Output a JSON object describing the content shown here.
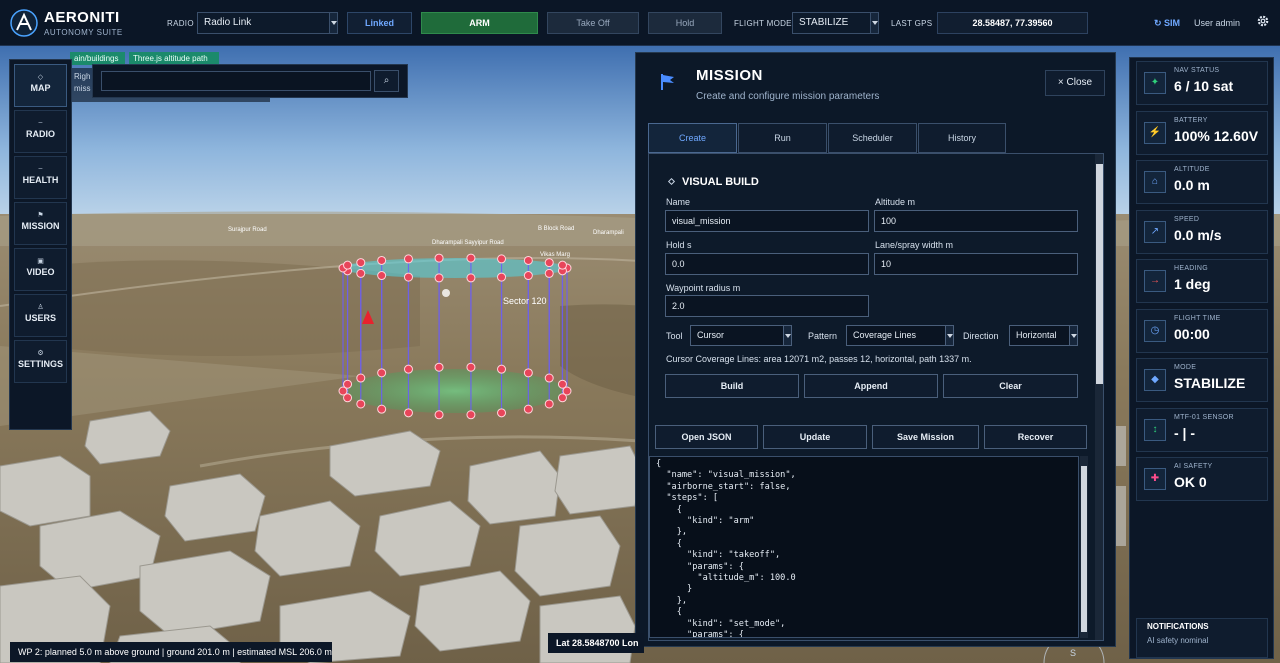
{
  "app": {
    "name": "AERONITI",
    "subtitle": "AUTONOMY SUITE"
  },
  "topbar": {
    "radio_label": "RADIO",
    "radio_value": "Radio Link",
    "linked_label": "Linked",
    "arm_label": "ARM",
    "takeoff_label": "Take Off",
    "hold_label": "Hold",
    "flight_mode_label": "FLIGHT MODE",
    "flight_mode_value": "STABILIZE",
    "last_gps_label": "LAST GPS",
    "last_gps_value": "28.58487, 77.39560",
    "sim_label": "↻ SIM",
    "user_label": "User admin",
    "gear_icon": "gear-icon"
  },
  "nav": {
    "items": [
      {
        "label": "MAP",
        "icon": "◇"
      },
      {
        "label": "RADIO",
        "icon": "–"
      },
      {
        "label": "HEALTH",
        "icon": "–"
      },
      {
        "label": "MISSION",
        "icon": "⚑"
      },
      {
        "label": "VIDEO",
        "icon": "▣"
      },
      {
        "label": "USERS",
        "icon": "♙"
      },
      {
        "label": "SETTINGS",
        "icon": "⚙"
      }
    ]
  },
  "map": {
    "tag_terrain": "ain/buildings",
    "tag_path": "Three.js altitude path",
    "info_line1": "Righ",
    "info_line2": "miss",
    "search_value": "",
    "search_button": "⌕",
    "sector_label": "Sector 120",
    "place_labels": [
      "Surajpur Road",
      "Dharampali Sayyipur Road",
      "Vikas Marg",
      "B Block Road",
      "Dharampali"
    ]
  },
  "mission": {
    "title": "MISSION",
    "subtitle": "Create and configure mission parameters",
    "close_label": "×  Close",
    "tabs": [
      "Create",
      "Run",
      "Scheduler",
      "History"
    ],
    "active_tab": "Create",
    "section_title": "VISUAL BUILD",
    "fields": {
      "name_label": "Name",
      "name_value": "visual_mission",
      "altitude_label": "Altitude m",
      "altitude_value": "100",
      "hold_label": "Hold s",
      "hold_value": "0.0",
      "lane_label": "Lane/spray width m",
      "lane_value": "10",
      "radius_label": "Waypoint radius m",
      "radius_value": "2.0"
    },
    "tool_label": "Tool",
    "tool_value": "Cursor",
    "pattern_label": "Pattern",
    "pattern_value": "Coverage Lines",
    "direction_label": "Direction",
    "direction_value": "Horizontal",
    "summary": "Cursor Coverage Lines: area 12071 m2, passes 12, horizontal, path 1337 m.",
    "build_label": "Build",
    "append_label": "Append",
    "clear_label": "Clear",
    "open_json_label": "Open JSON",
    "update_label": "Update",
    "save_label": "Save Mission",
    "recover_label": "Recover",
    "json_text": "{\n  \"name\": \"visual_mission\",\n  \"airborne_start\": false,\n  \"steps\": [\n    {\n      \"kind\": \"arm\"\n    },\n    {\n      \"kind\": \"takeoff\",\n      \"params\": {\n        \"altitude_m\": 100.0\n      }\n    },\n    {\n      \"kind\": \"set_mode\",\n      \"params\": {"
  },
  "status": {
    "cards": [
      {
        "label": "NAV STATUS",
        "value": "6 / 10 sat",
        "icon": "✦",
        "icon_name": "satellite-icon",
        "color": "#2fd07a"
      },
      {
        "label": "BATTERY",
        "value": "100% 12.60V",
        "icon": "⚡",
        "icon_name": "battery-icon",
        "color": "#2fd07a"
      },
      {
        "label": "ALTITUDE",
        "value": "0.0 m",
        "icon": "⌂",
        "icon_name": "altitude-icon",
        "color": "#6fa8ff"
      },
      {
        "label": "SPEED",
        "value": "0.0 m/s",
        "icon": "↗",
        "icon_name": "speed-icon",
        "color": "#6fa8ff"
      },
      {
        "label": "HEADING",
        "value": "1 deg",
        "icon": "→",
        "icon_name": "heading-icon",
        "color": "#ff5a5a"
      },
      {
        "label": "FLIGHT TIME",
        "value": "00:00",
        "icon": "◷",
        "icon_name": "clock-icon",
        "color": "#6fa8ff"
      },
      {
        "label": "MODE",
        "value": "STABILIZE",
        "icon": "◆",
        "icon_name": "mode-icon",
        "color": "#6fa8ff"
      },
      {
        "label": "MTF-01 SENSOR",
        "value": "- | -",
        "icon": "↕",
        "icon_name": "sensor-icon",
        "color": "#2fd07a"
      },
      {
        "label": "AI SAFETY",
        "value": "OK 0",
        "icon": "✚",
        "icon_name": "ai-safety-icon",
        "color": "#ff4d8d"
      }
    ],
    "notifications_title": "NOTIFICATIONS",
    "notifications_text": "AI safety nominal"
  },
  "footer": {
    "wp_text": "WP 2: planned 5.0 m above ground | ground 201.0 m | estimated MSL 206.0 m",
    "lat_text": "Lat 28.5848700  Lon"
  }
}
